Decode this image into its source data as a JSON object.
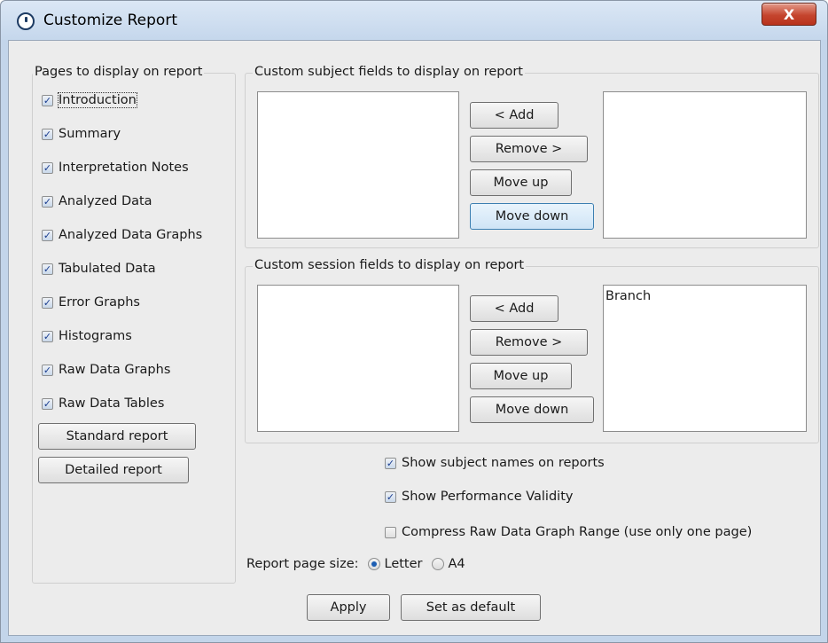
{
  "window": {
    "title": "Customize Report",
    "close_label": "X"
  },
  "pages_group": {
    "legend": "Pages to display on report",
    "items": [
      {
        "label": "Introduction",
        "checked": true
      },
      {
        "label": "Summary",
        "checked": true
      },
      {
        "label": "Interpretation Notes",
        "checked": true
      },
      {
        "label": "Analyzed Data",
        "checked": true
      },
      {
        "label": "Analyzed Data Graphs",
        "checked": true
      },
      {
        "label": "Tabulated Data",
        "checked": true
      },
      {
        "label": "Error Graphs",
        "checked": true
      },
      {
        "label": "Histograms",
        "checked": true
      },
      {
        "label": "Raw Data Graphs",
        "checked": true
      },
      {
        "label": "Raw Data Tables",
        "checked": true
      }
    ],
    "standard_button": "Standard report",
    "detailed_button": "Detailed report"
  },
  "subject_group": {
    "legend": "Custom subject fields to display on report",
    "add": "< Add",
    "remove": "Remove >",
    "move_up": "Move up",
    "move_down": "Move down",
    "available": [],
    "selected": []
  },
  "session_group": {
    "legend": "Custom session fields to display on report",
    "add": "< Add",
    "remove": "Remove >",
    "move_up": "Move up",
    "move_down": "Move down",
    "available": [],
    "selected": [
      "Branch"
    ]
  },
  "options": {
    "show_subject_names": {
      "label": "Show subject names on reports",
      "checked": true
    },
    "show_performance_validity": {
      "label": "Show Performance Validity",
      "checked": true
    },
    "compress_raw": {
      "label": "Compress Raw Data Graph Range (use only one page)",
      "checked": false
    }
  },
  "page_size": {
    "label": "Report page size:",
    "options": [
      "Letter",
      "A4"
    ],
    "selected": "Letter"
  },
  "footer": {
    "apply": "Apply",
    "set_default": "Set as default"
  },
  "icons": {
    "check": "✓",
    "title_icon": "app-icon"
  }
}
